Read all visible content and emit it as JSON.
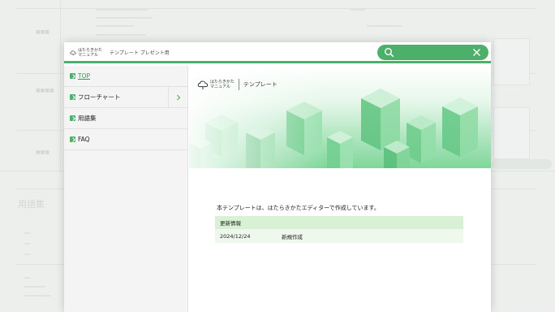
{
  "window": {
    "logo_text": "はたらきかた\nマニュアル",
    "subtitle": "テンプレート プレゼント用",
    "search": {
      "placeholder": "",
      "value": ""
    }
  },
  "sidebar": {
    "items": [
      {
        "label": "TOP",
        "active": true
      },
      {
        "label": "フローチャート",
        "has_submenu": true
      },
      {
        "label": "用語集"
      },
      {
        "label": "FAQ"
      }
    ]
  },
  "content": {
    "hero_logo_text": "はたらきかた\nマニュアル",
    "hero_label": "テンプレート",
    "intro": "本テンプレートは、はたらきかたエディターで作成しています。",
    "updates": {
      "header": "更新情報",
      "rows": [
        {
          "date": "2024/12/24",
          "text": "新規作成"
        }
      ]
    }
  },
  "background": {
    "title": "用語集"
  },
  "colors": {
    "accent": "#4caf6a",
    "table_header": "#d8f0d4",
    "table_row": "#eef8ec"
  },
  "icons": [
    "search-icon",
    "close-icon",
    "chevron-right-icon",
    "cloud-logo-icon"
  ]
}
